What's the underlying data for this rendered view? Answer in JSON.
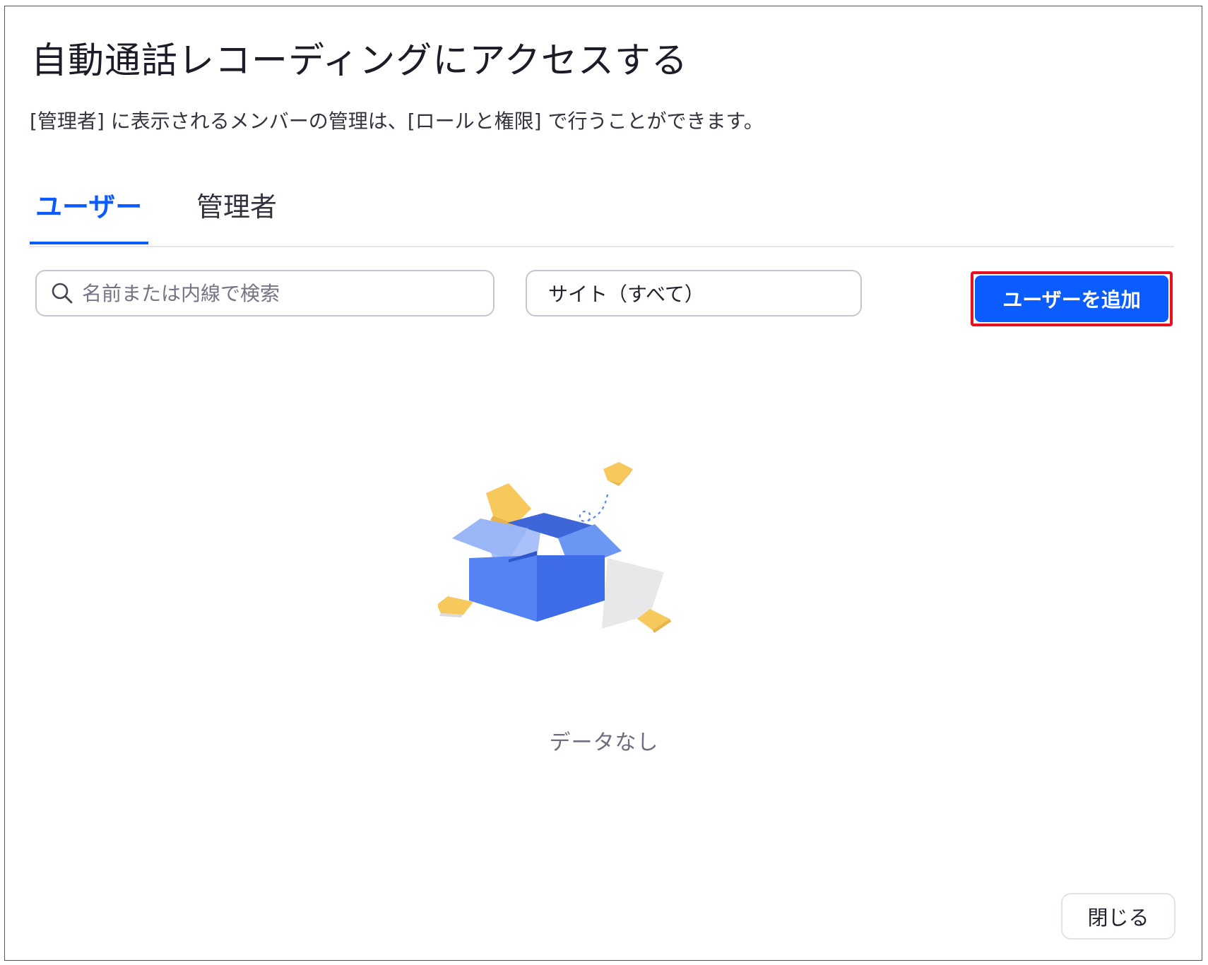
{
  "dialog": {
    "title": "自動通話レコーディングにアクセスする",
    "description": "[管理者] に表示されるメンバーの管理は、[ロールと権限] で行うことができます。"
  },
  "tabs": [
    {
      "label": "ユーザー",
      "active": true
    },
    {
      "label": "管理者",
      "active": false
    }
  ],
  "search": {
    "placeholder": "名前または内線で検索",
    "value": "",
    "icon": "search-icon"
  },
  "site_filter": {
    "selected": "サイト（すべて）"
  },
  "add_user_button": {
    "label": "ユーザーを追加",
    "highlighted": true
  },
  "empty_state": {
    "message": "データなし",
    "icon": "empty-box-icon"
  },
  "close_button": {
    "label": "閉じる"
  },
  "colors": {
    "accent": "#0b5cff",
    "highlight_border": "#e8101e",
    "box_front": "#4a7cf0",
    "box_light": "#8fb0f7",
    "paper": "#f7c95c"
  }
}
